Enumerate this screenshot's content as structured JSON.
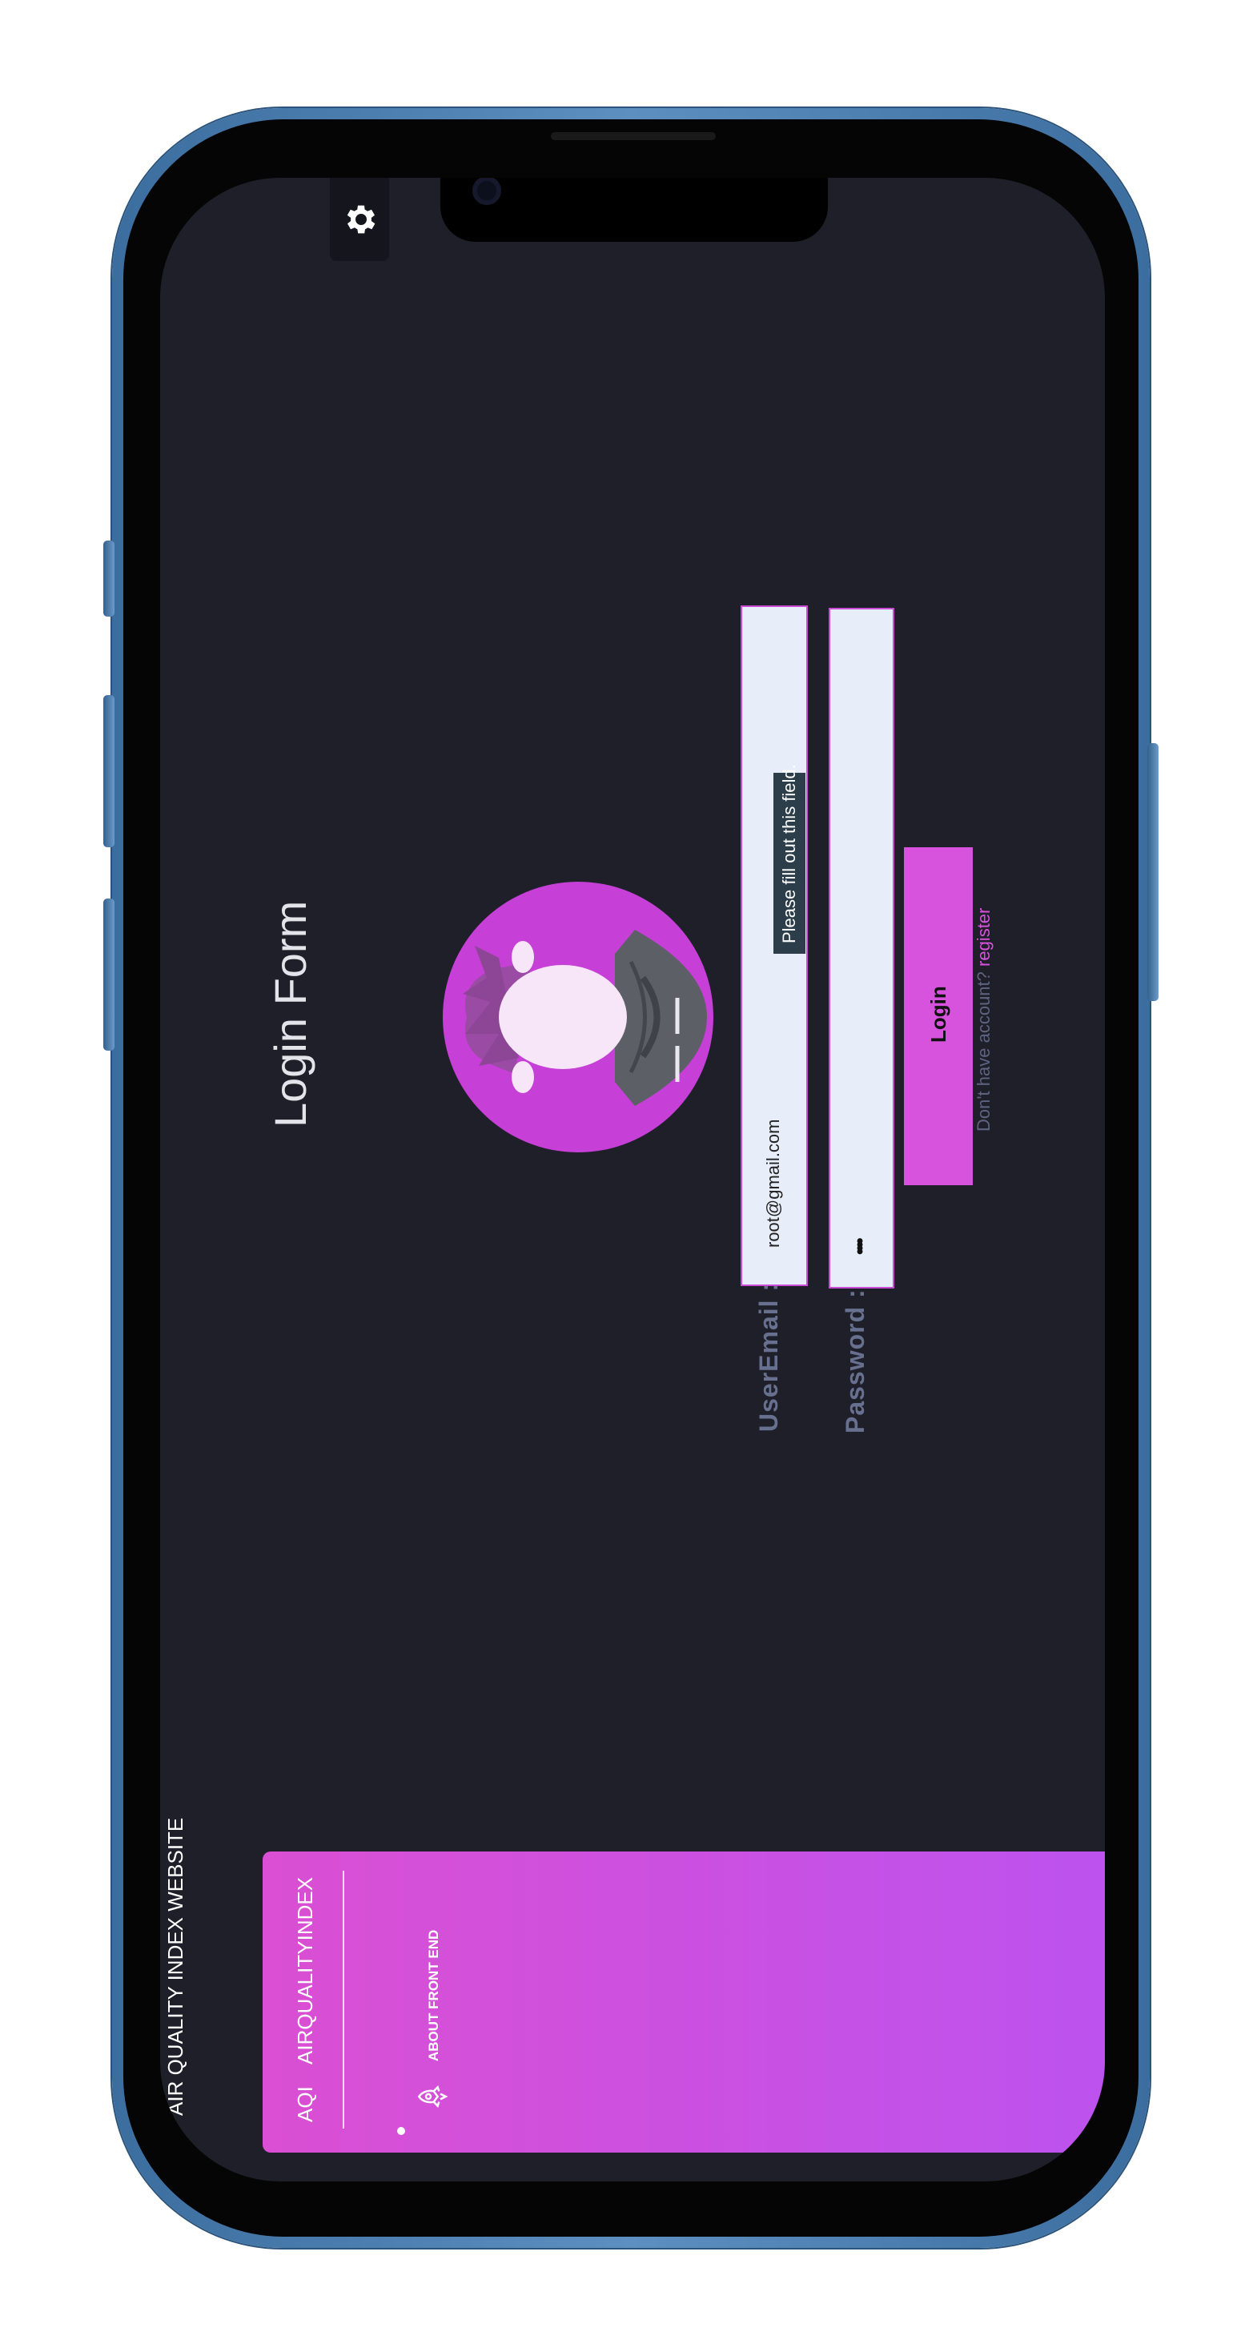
{
  "app": {
    "vertical_label": "AIR QUALITY INDEX WEBSITE"
  },
  "form": {
    "title": "Login Form",
    "email_label": "UserEmail :",
    "email_value": "root@gmail.com",
    "password_label": "Password :",
    "password_value": "••••",
    "tooltip": "Please fill out this field.",
    "login_button": "Login",
    "register_prompt": "Don't have account?",
    "register_link": "register"
  },
  "navbar": {
    "brand": "AQI",
    "brand_full": "AIRQUALITYINDEX",
    "about_link": "ABOUT FRONT END"
  },
  "icons": {
    "settings": "gear-icon",
    "rocket": "rocket-icon",
    "avatar": "user-avatar"
  },
  "colors": {
    "screen_bg": "#1e1f28",
    "accent": "#d752dd",
    "avatar_bg": "#c63fd6",
    "input_bg": "#e8eef9",
    "navbar_start": "#da4fd3",
    "navbar_end": "#bd52ee"
  }
}
